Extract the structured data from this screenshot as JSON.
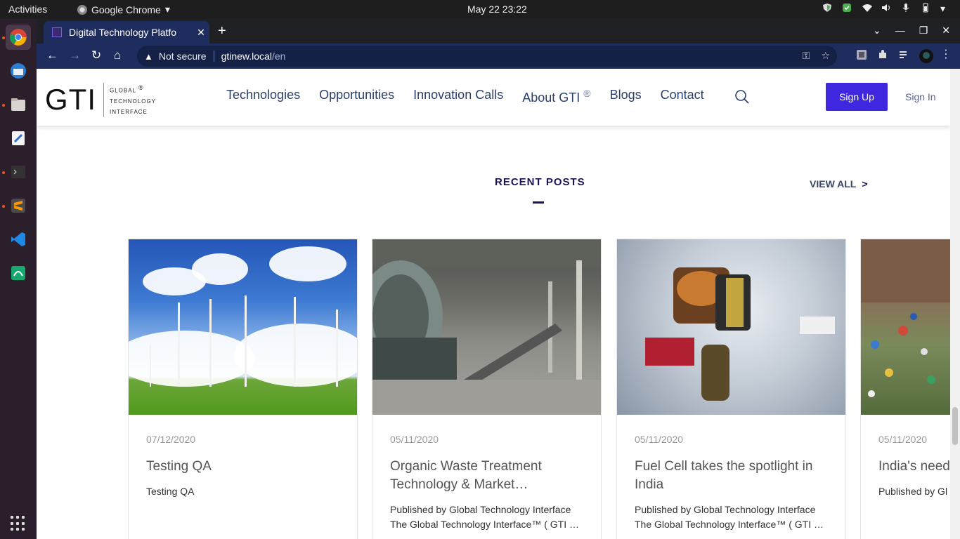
{
  "system_bar": {
    "activities": "Activities",
    "app_name": "Google Chrome",
    "clock": "May 22  23:22"
  },
  "browser": {
    "tab_title": "Digital Technology Platfo",
    "security_label": "Not secure",
    "url_host": "gtinew.local",
    "url_path": "/en"
  },
  "site": {
    "logo_big": "GTI",
    "logo_line1": "GLOBAL",
    "logo_line2": "TECHNOLOGY",
    "logo_line3": "INTERFACE",
    "logo_reg": "®",
    "nav": {
      "technologies": "Technologies",
      "opportunities": "Opportunities",
      "innovation_calls": "Innovation Calls",
      "about": "About GTI",
      "about_reg": "®",
      "blogs": "Blogs",
      "contact": "Contact"
    },
    "signup": "Sign Up",
    "signin": "Sign In"
  },
  "recent_posts": {
    "title": "RECENT POSTS",
    "view_all": "VIEW ALL",
    "view_all_chevron": ">",
    "posts": [
      {
        "date": "07/12/2020",
        "title": "Testing QA",
        "excerpt": "Testing QA"
      },
      {
        "date": "05/11/2020",
        "title": "Organic Waste Treatment Technology & Market…",
        "excerpt": "Published by Global Technology Interface The Global Technology Interface™ ( GTI …"
      },
      {
        "date": "05/11/2020",
        "title": "Fuel Cell takes the spotlight in India",
        "excerpt": "Published by Global Technology Interface The Global Technology Interface™ ( GTI …"
      },
      {
        "date": "05/11/2020",
        "title": "India's need f technologies",
        "excerpt": "Published by Gl The Global Tech"
      }
    ]
  }
}
